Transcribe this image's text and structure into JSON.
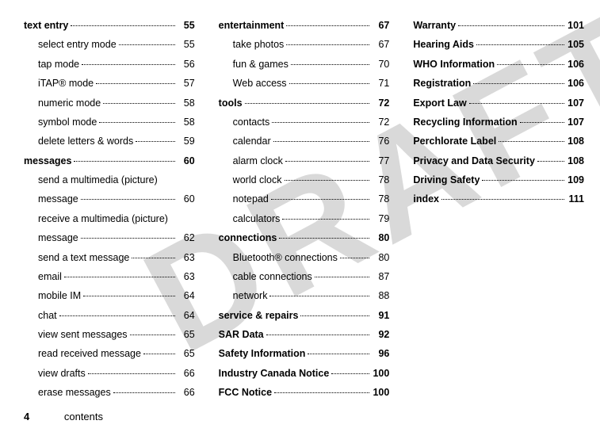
{
  "watermark": "DRAFT",
  "footer": {
    "pageNumber": "4",
    "section": "contents"
  },
  "columns": [
    [
      {
        "label": "text entry",
        "page": "55",
        "bold": true,
        "indent": false
      },
      {
        "label": "select entry mode",
        "page": "55",
        "bold": false,
        "indent": true
      },
      {
        "label": "tap mode",
        "page": "56",
        "bold": false,
        "indent": true
      },
      {
        "label": "iTAP® mode",
        "page": "57",
        "bold": false,
        "indent": true
      },
      {
        "label": "numeric mode",
        "page": "58",
        "bold": false,
        "indent": true
      },
      {
        "label": "symbol mode",
        "page": "58",
        "bold": false,
        "indent": true
      },
      {
        "label": "delete letters & words",
        "page": "59",
        "bold": false,
        "indent": true
      },
      {
        "label": "messages",
        "page": "60",
        "bold": true,
        "indent": false
      },
      {
        "label": "send a multimedia (picture)",
        "page": "",
        "bold": false,
        "indent": true,
        "nodots": true
      },
      {
        "label": "message",
        "page": "60",
        "bold": false,
        "indent": true
      },
      {
        "label": "receive a multimedia (picture)",
        "page": "",
        "bold": false,
        "indent": true,
        "nodots": true
      },
      {
        "label": "message",
        "page": "62",
        "bold": false,
        "indent": true
      },
      {
        "label": "send a text message",
        "page": "63",
        "bold": false,
        "indent": true
      },
      {
        "label": "email",
        "page": "63",
        "bold": false,
        "indent": true
      },
      {
        "label": "mobile IM",
        "page": "64",
        "bold": false,
        "indent": true
      },
      {
        "label": "chat",
        "page": "64",
        "bold": false,
        "indent": true
      },
      {
        "label": "view sent messages",
        "page": "65",
        "bold": false,
        "indent": true
      },
      {
        "label": "read received message",
        "page": "65",
        "bold": false,
        "indent": true
      },
      {
        "label": "view drafts",
        "page": "66",
        "bold": false,
        "indent": true
      },
      {
        "label": "erase messages",
        "page": "66",
        "bold": false,
        "indent": true
      }
    ],
    [
      {
        "label": "entertainment",
        "page": "67",
        "bold": true,
        "indent": false
      },
      {
        "label": "take photos",
        "page": "67",
        "bold": false,
        "indent": true
      },
      {
        "label": "fun & games",
        "page": "70",
        "bold": false,
        "indent": true
      },
      {
        "label": "Web access",
        "page": "71",
        "bold": false,
        "indent": true
      },
      {
        "label": "tools",
        "page": "72",
        "bold": true,
        "indent": false
      },
      {
        "label": "contacts",
        "page": "72",
        "bold": false,
        "indent": true
      },
      {
        "label": "calendar",
        "page": "76",
        "bold": false,
        "indent": true
      },
      {
        "label": "alarm clock",
        "page": "77",
        "bold": false,
        "indent": true
      },
      {
        "label": "world clock",
        "page": "78",
        "bold": false,
        "indent": true
      },
      {
        "label": "notepad",
        "page": "78",
        "bold": false,
        "indent": true
      },
      {
        "label": "calculators",
        "page": "79",
        "bold": false,
        "indent": true
      },
      {
        "label": "connections",
        "page": "80",
        "bold": true,
        "indent": false
      },
      {
        "label": "Bluetooth® connections",
        "page": "80",
        "bold": false,
        "indent": true
      },
      {
        "label": "cable connections",
        "page": "87",
        "bold": false,
        "indent": true
      },
      {
        "label": "network",
        "page": "88",
        "bold": false,
        "indent": true
      },
      {
        "label": "service & repairs",
        "page": "91",
        "bold": true,
        "indent": false
      },
      {
        "label": "SAR Data",
        "page": "92",
        "bold": true,
        "indent": false
      },
      {
        "label": "Safety Information",
        "page": "96",
        "bold": true,
        "indent": false
      },
      {
        "label": "Industry Canada Notice",
        "page": "100",
        "bold": true,
        "indent": false
      },
      {
        "label": "FCC Notice",
        "page": "100",
        "bold": true,
        "indent": false
      }
    ],
    [
      {
        "label": "Warranty",
        "page": "101",
        "bold": true,
        "indent": false
      },
      {
        "label": "Hearing Aids",
        "page": "105",
        "bold": true,
        "indent": false
      },
      {
        "label": "WHO Information",
        "page": "106",
        "bold": true,
        "indent": false
      },
      {
        "label": "Registration",
        "page": "106",
        "bold": true,
        "indent": false
      },
      {
        "label": "Export Law",
        "page": "107",
        "bold": true,
        "indent": false
      },
      {
        "label": "Recycling Information",
        "page": "107",
        "bold": true,
        "indent": false
      },
      {
        "label": "Perchlorate Label",
        "page": "108",
        "bold": true,
        "indent": false
      },
      {
        "label": "Privacy and Data Security",
        "page": "108",
        "bold": true,
        "indent": false
      },
      {
        "label": "Driving Safety",
        "page": "109",
        "bold": true,
        "indent": false
      },
      {
        "label": "index",
        "page": "111",
        "bold": true,
        "indent": false
      }
    ]
  ]
}
